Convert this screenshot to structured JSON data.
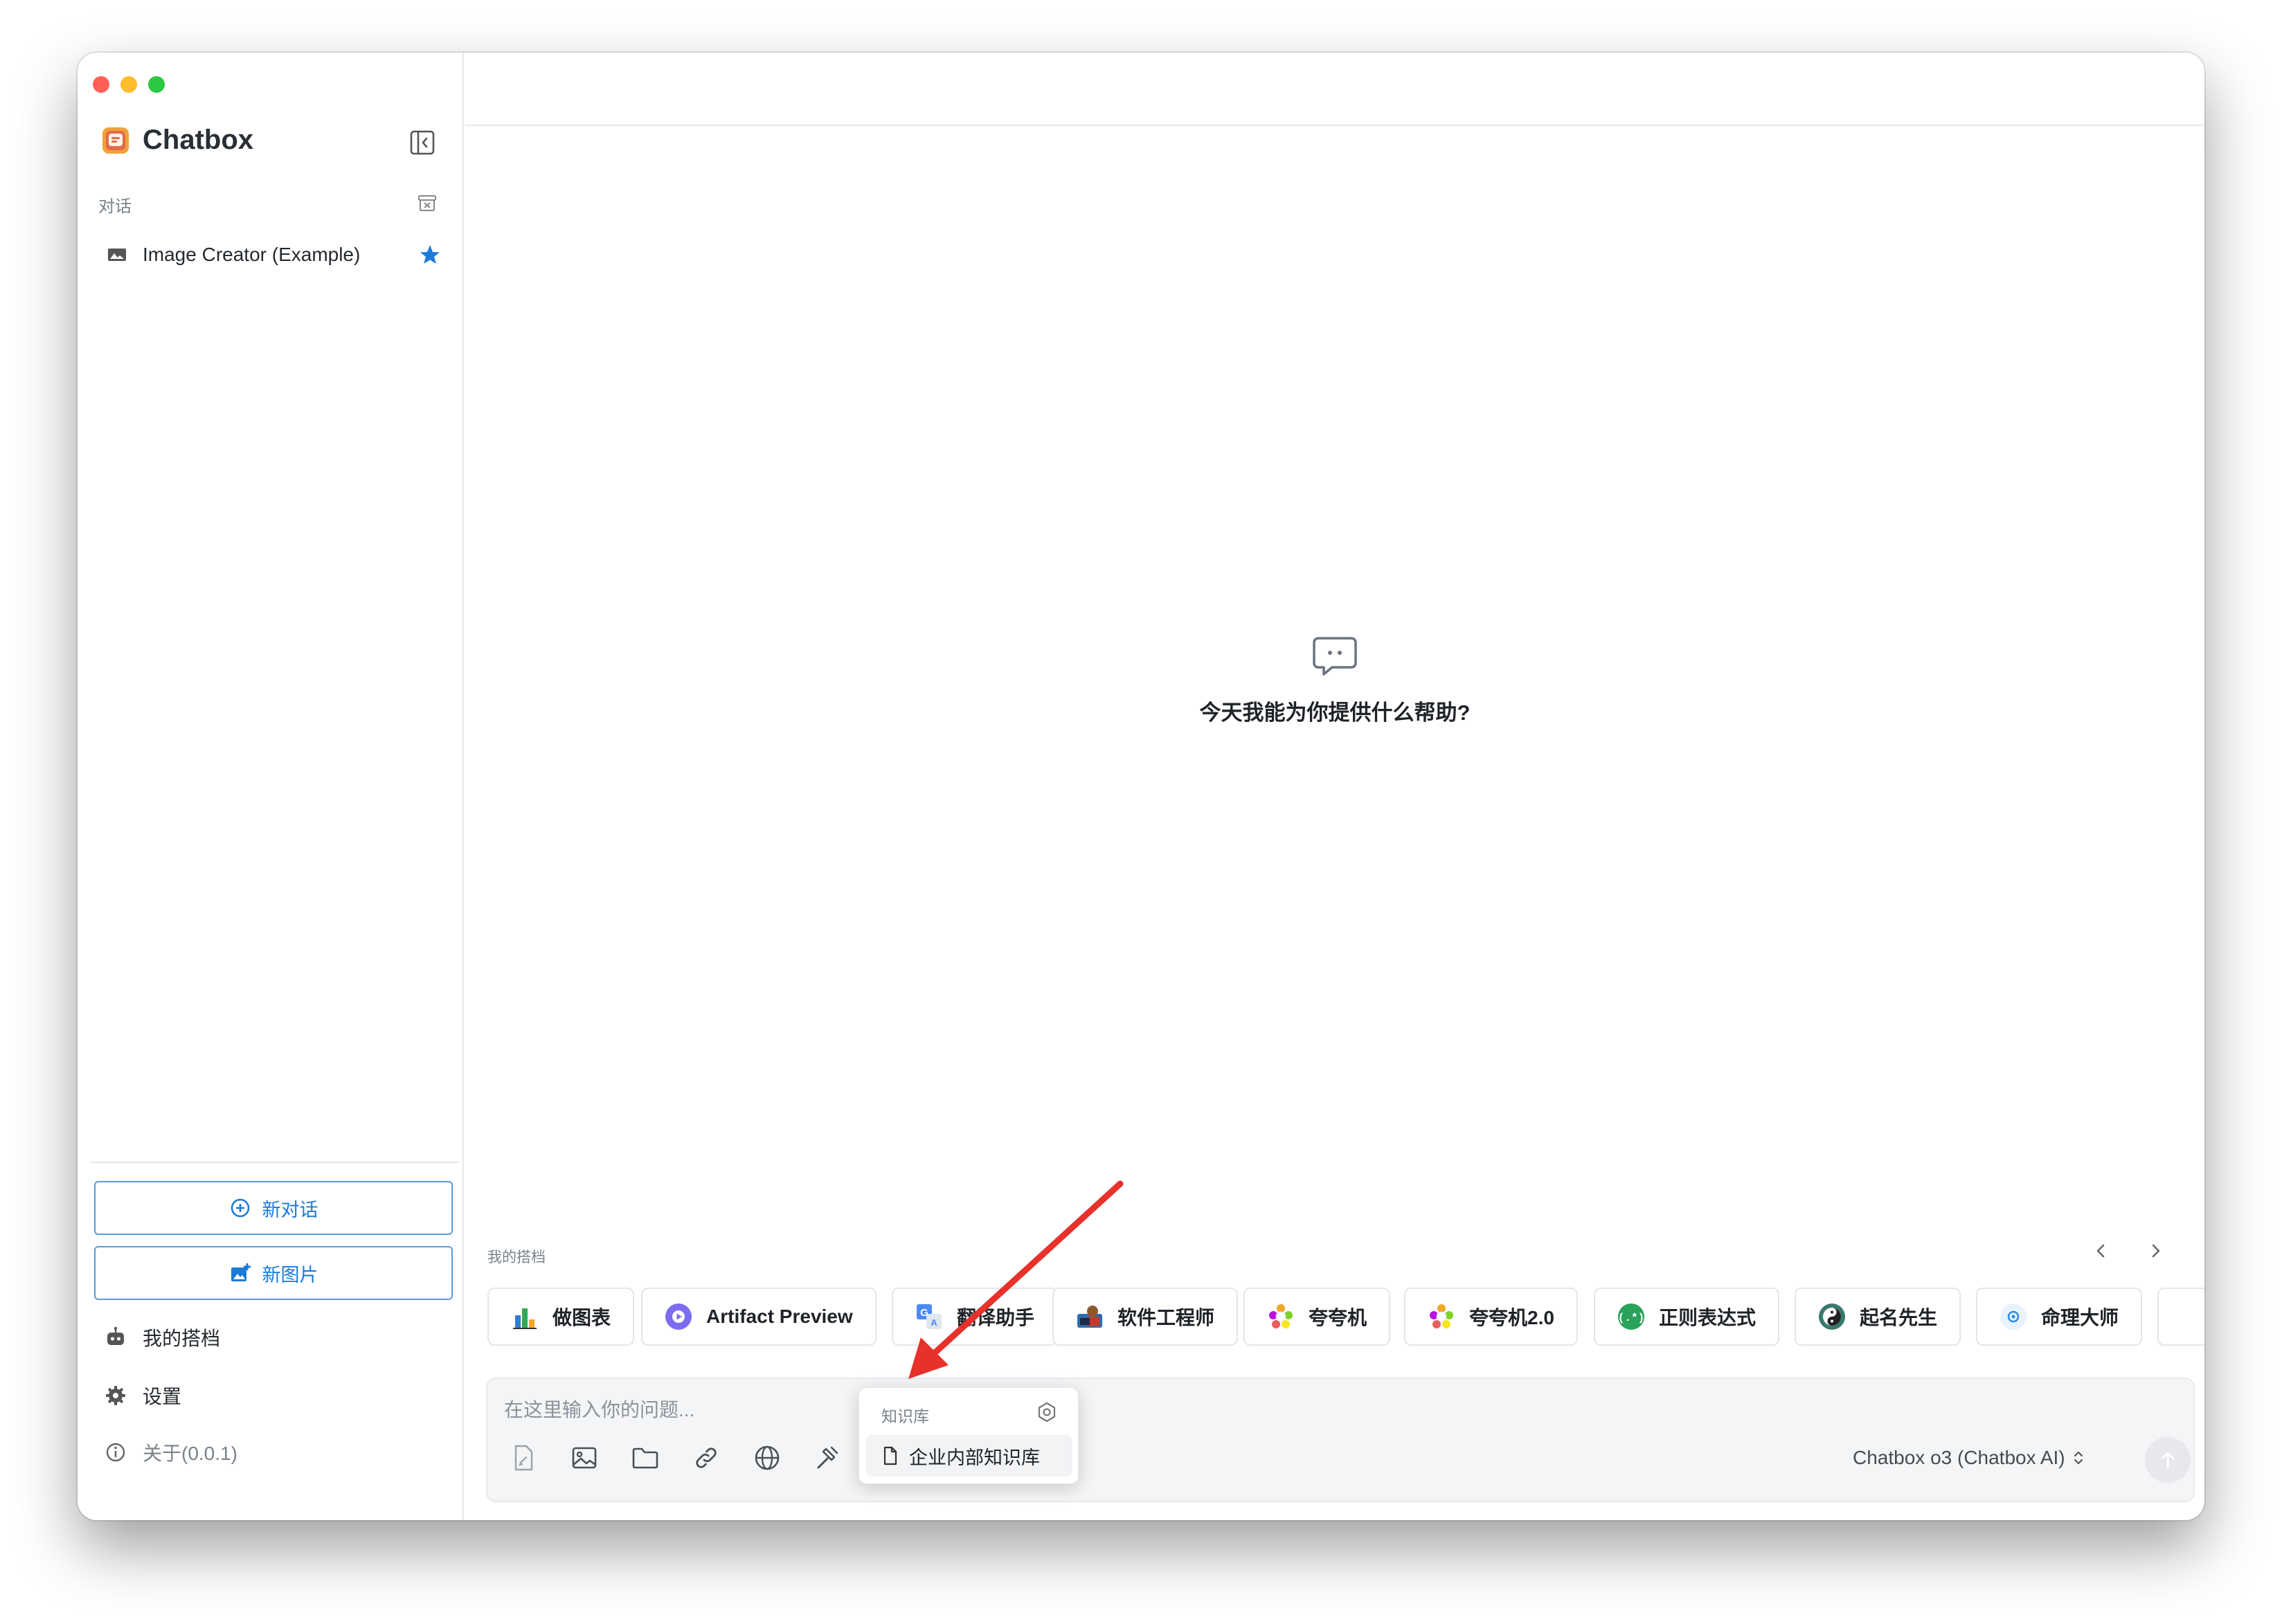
{
  "app": {
    "name": "Chatbox"
  },
  "sidebar": {
    "section_title": "对话",
    "conversations": [
      {
        "label": "Image Creator (Example)",
        "starred": true
      }
    ],
    "new_chat_label": "新对话",
    "new_image_label": "新图片",
    "nav": {
      "partners": "我的搭档",
      "settings": "设置",
      "about": "关于(0.0.1)"
    }
  },
  "main": {
    "empty_message": "今天我能为你提供什么帮助?",
    "partners_label": "我的搭档",
    "partners": [
      {
        "label": "做图表",
        "icon": "bar-chart-icon"
      },
      {
        "label": "Artifact Preview",
        "icon": "play-circle-icon"
      },
      {
        "label": "翻译助手",
        "icon": "translate-icon"
      },
      {
        "label": "软件工程师",
        "icon": "engineer-avatar-icon"
      },
      {
        "label": "夸夸机",
        "icon": "flower-icon"
      },
      {
        "label": "夸夸机2.0",
        "icon": "flower-icon"
      },
      {
        "label": "正则表达式",
        "icon": "regex-icon"
      },
      {
        "label": "起名先生",
        "icon": "yin-yang-icon"
      },
      {
        "label": "命理大师",
        "icon": "fortune-icon"
      }
    ]
  },
  "composer": {
    "placeholder": "在这里输入你的问题...",
    "model": "Chatbox o3 (Chatbox AI)",
    "tools": [
      "attach-file-icon",
      "image-icon",
      "folder-icon",
      "link-icon",
      "globe-icon",
      "hammer-icon",
      "book-icon",
      "sliders-icon"
    ]
  },
  "knowledge_popup": {
    "title": "知识库",
    "items": [
      {
        "label": "企业内部知识库"
      }
    ]
  },
  "colors": {
    "accent": "#1c7ad9",
    "annotation_arrow": "#e8312b"
  }
}
